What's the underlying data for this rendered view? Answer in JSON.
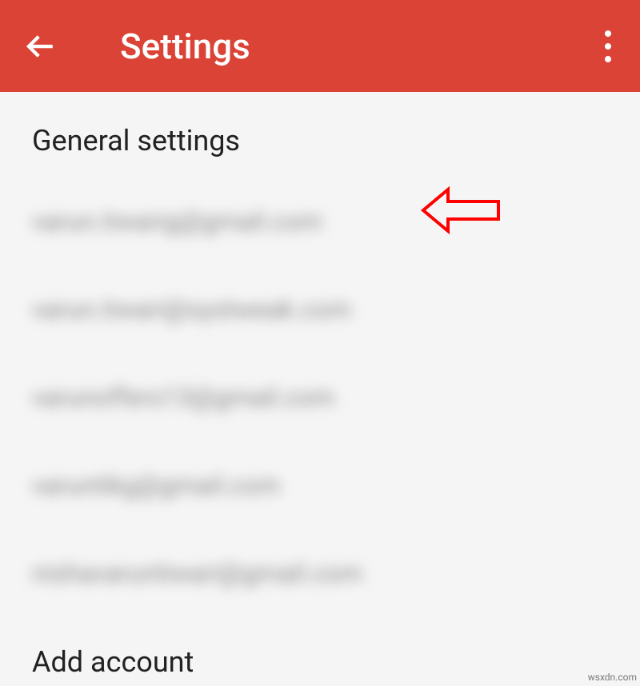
{
  "header": {
    "title": "Settings"
  },
  "content": {
    "general_label": "General settings",
    "add_account_label": "Add account"
  },
  "accounts": [
    "varun.tiwarig@gmail.com",
    "varun.tiwari@systweak.com",
    "varunoffers13@gmail.com",
    "varuntikg@gmail.com",
    "nishavaruntiwari@gmail.com"
  ],
  "annotation": {
    "color": "#ff0000"
  },
  "watermark": "wsxdn.com"
}
